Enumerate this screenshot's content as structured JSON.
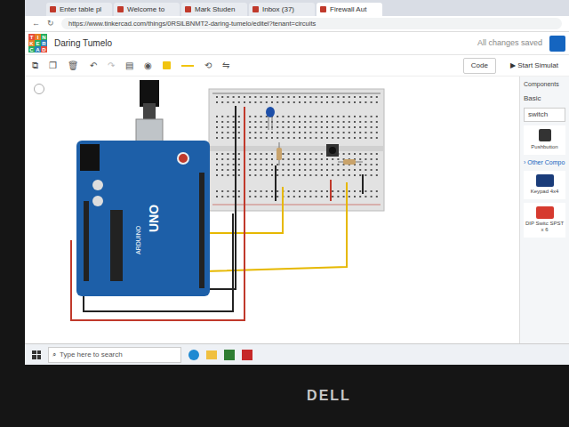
{
  "browser": {
    "tabs": [
      {
        "label": "Enter table pl",
        "selected": false
      },
      {
        "label": "Welcome to",
        "selected": false
      },
      {
        "label": "Mark Studen",
        "selected": false
      },
      {
        "label": "Inbox (37)",
        "selected": false
      },
      {
        "label": "Firewall Aut",
        "selected": true
      }
    ],
    "url": "https://www.tinkercad.com/things/0RSlLBNMT2-daring-tumelo/editel?tenant=circuits"
  },
  "app": {
    "logo": [
      "TIN",
      "KER",
      "CAD"
    ],
    "title": "Daring Tumelo",
    "status": "All changes saved",
    "code_button": "Code",
    "simulate_button": "Start Simulat"
  },
  "components_panel": {
    "title": "Components",
    "category": "Basic",
    "search": "switch",
    "items": [
      {
        "label": "Pushbutton"
      }
    ],
    "section": "Other Compo",
    "other_items": [
      {
        "label": "Keypad 4x4"
      },
      {
        "label": "DIP Switc SPST x 6"
      }
    ]
  },
  "board": {
    "name": "ARDUINO",
    "model": "UNO"
  },
  "taskbar": {
    "search_placeholder": "Type here to search"
  },
  "laptop": {
    "brand": "DELL"
  }
}
